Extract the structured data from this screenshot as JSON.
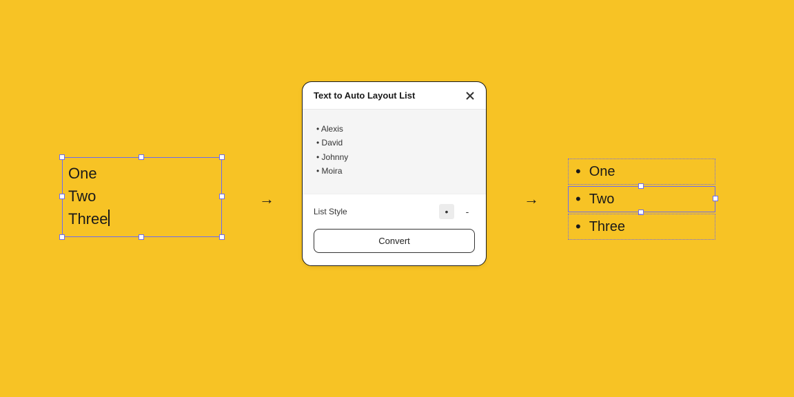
{
  "input_text": {
    "lines": [
      "One",
      "Two",
      "Three"
    ]
  },
  "dialog": {
    "title": "Text to Auto Layout List",
    "preview_items": [
      "Alexis",
      "David",
      "Johnny",
      "Moira"
    ],
    "list_style_label": "List Style",
    "style_bullet": "•",
    "style_dash": "-",
    "convert_label": "Convert"
  },
  "output_list": {
    "items": [
      "One",
      "Two",
      "Three"
    ],
    "selected_index": 1
  },
  "arrow_glyph": "→"
}
